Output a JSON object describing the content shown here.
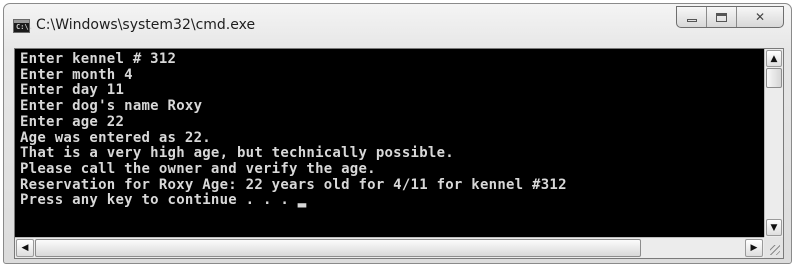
{
  "window": {
    "title": "C:\\Windows\\system32\\cmd.exe",
    "icon": "cmd-app-icon",
    "icon_text": "C:\\."
  },
  "caption_buttons": [
    {
      "name": "minimize",
      "icon": "minimize-icon"
    },
    {
      "name": "maximize",
      "icon": "maximize-icon"
    },
    {
      "name": "close",
      "icon": "close-icon",
      "glyph": "✕"
    }
  ],
  "console": {
    "text_color": "#d8d8d8",
    "background": "#000000",
    "lines": [
      "Enter kennel # 312",
      "Enter month 4",
      "Enter day 11",
      "Enter dog's name Roxy",
      "Enter age 22",
      "Age was entered as 22.",
      "That is a very high age, but technically possible.",
      "Please call the owner and verify the age.",
      "Reservation for Roxy Age: 22 years old for 4/11 for kennel #312",
      "Press any key to continue . . . "
    ],
    "cursor": "▂"
  },
  "scrollbars": {
    "up_arrow": "▲",
    "down_arrow": "▼",
    "left_arrow": "◀",
    "right_arrow": "▶"
  }
}
